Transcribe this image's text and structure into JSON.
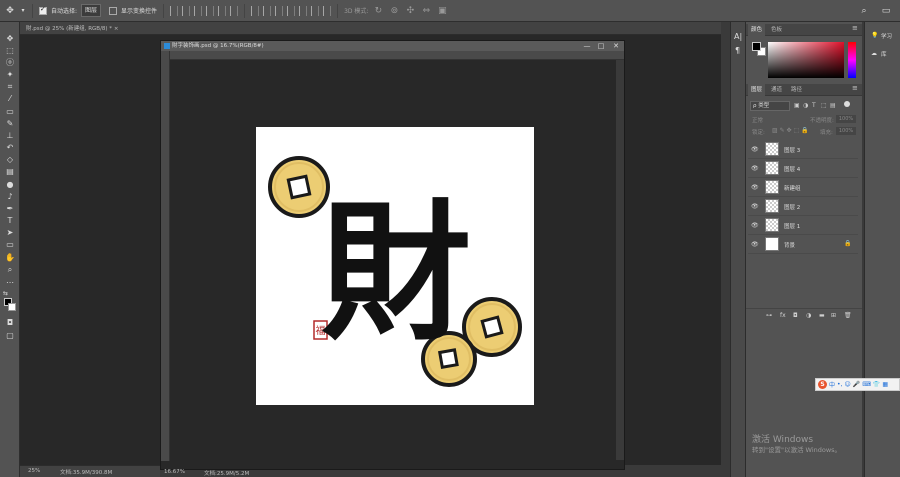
{
  "options_bar": {
    "auto_select_label": "自动选择:",
    "auto_select_value": "图层",
    "show_transform_label": "显示变换控件",
    "mode_3d_label": "3D 模式:"
  },
  "doc_tab": {
    "title": "財.psd @ 25% (新建组, RGB/8) *",
    "close": "×"
  },
  "float_window": {
    "title": "財字装饰画.psd @ 16.7%(RGB/8#)",
    "btn_min": "—",
    "btn_max": "□",
    "btn_close": "✕"
  },
  "status": {
    "zoom_main": "25%",
    "doc_main": "文档:35.9M/390.8M",
    "zoom_float": "16.67%",
    "doc_float": "文档:25.9M/5.2M"
  },
  "artwork": {
    "character": "財",
    "seal_text": "福",
    "coin_color": "#e8c86e"
  },
  "icon_strip": [
    "A|",
    "¶"
  ],
  "color_panel": {
    "tabs": [
      "颜色",
      "色板"
    ]
  },
  "layers_panel": {
    "tabs": [
      "图层",
      "通道",
      "路径"
    ],
    "filter_label": "ρ 类型",
    "blend_mode": "正常",
    "opacity_label": "不透明度:",
    "opacity_value": "100%",
    "lock_label": "锁定:",
    "fill_label": "填充:",
    "fill_value": "100%",
    "layers": [
      {
        "name": "图层 3",
        "thumb": "checker"
      },
      {
        "name": "图层 4",
        "thumb": "checker"
      },
      {
        "name": "新建组",
        "thumb": "checker"
      },
      {
        "name": "图层 2",
        "thumb": "checker"
      },
      {
        "name": "图层 1",
        "thumb": "checker"
      },
      {
        "name": "背景",
        "thumb": "plain",
        "locked": true
      }
    ],
    "footer_icons": [
      "link-icon",
      "fx-icon",
      "mask-icon",
      "adjustment-icon",
      "group-icon",
      "new-layer-icon",
      "trash-icon"
    ]
  },
  "learn_panel": {
    "items": [
      "学习",
      "库"
    ]
  },
  "watermark": {
    "line1": "激活 Windows",
    "line2": "转到\"设置\"以激活 Windows。"
  }
}
